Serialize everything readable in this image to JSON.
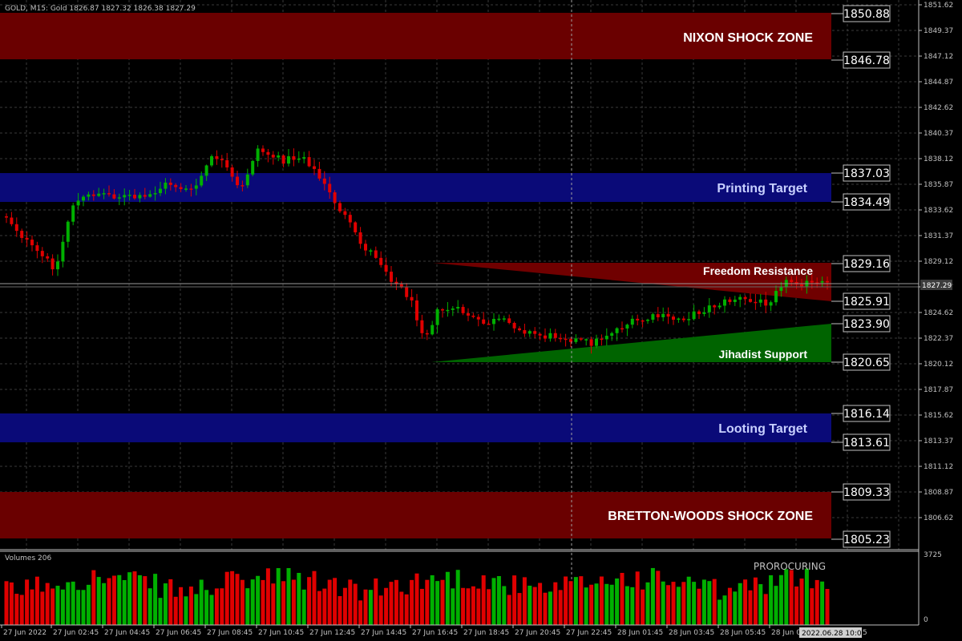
{
  "header": {
    "info": "GOLD, M15:  Gold  1826.87 1827.32 1826.38 1827.29"
  },
  "colors": {
    "background": "#000000",
    "grid": "#3a3a3a",
    "bull": "#00b000",
    "bear": "#e00000",
    "shock_zone": "#6a0000",
    "target_zone": "#0a0a78",
    "support_zone": "#006400",
    "resistance_zone": "#700000",
    "axis_text": "#c0c0c0",
    "current_price_bg": "#3c3c3c"
  },
  "price_axis": {
    "ticks": [
      "1851.62",
      "1849.37",
      "1847.12",
      "1844.87",
      "1842.62",
      "1840.37",
      "1838.12",
      "1835.87",
      "1833.62",
      "1831.37",
      "1829.12",
      "1826.87",
      "1824.62",
      "1822.37",
      "1820.12",
      "1817.87",
      "1815.62",
      "1813.37",
      "1811.12",
      "1808.87",
      "1806.62"
    ],
    "current_price": "1827.29"
  },
  "time_axis": {
    "labels": [
      "27 Jun 2022",
      "27 Jun 02:45",
      "27 Jun 04:45",
      "27 Jun 06:45",
      "27 Jun 08:45",
      "27 Jun 10:45",
      "27 Jun 12:45",
      "27 Jun 14:45",
      "27 Jun 16:45",
      "27 Jun 18:45",
      "27 Jun 20:45",
      "27 Jun 22:45",
      "28 Jun 01:45",
      "28 Jun 03:45",
      "28 Jun 05:45",
      "28 Jun 0"
    ],
    "crosshair_label": "2022.06.28 10:02",
    "label_tail": "5"
  },
  "zones": [
    {
      "id": "nixon",
      "label": "NIXON SHOCK ZONE",
      "top": "1850.88",
      "bottom": "1846.78",
      "text_color": "#ffffff"
    },
    {
      "id": "printing",
      "label": "Printing Target",
      "top": "1837.03",
      "bottom": "1834.49",
      "text_color": "#c8d0ff"
    },
    {
      "id": "freedom",
      "label": "Freedom Resistance",
      "top": "1829.16",
      "bottom": "1825.91",
      "text_color": "#ffffff"
    },
    {
      "id": "jihadist",
      "label": "Jihadist Support",
      "top": "1823.90",
      "bottom": "1820.65",
      "text_color": "#ffffff"
    },
    {
      "id": "looting",
      "label": "Looting Target",
      "top": "1816.14",
      "bottom": "1813.61",
      "text_color": "#c8d0ff"
    },
    {
      "id": "bretton",
      "label": "BRETTON-WOODS SHOCK ZONE",
      "top": "1809.33",
      "bottom": "1805.23",
      "text_color": "#ffffff"
    }
  ],
  "volume": {
    "label": "Volumes 206",
    "scale_max": "3725",
    "scale_min": "0",
    "watermark": "PROROCURING"
  }
}
